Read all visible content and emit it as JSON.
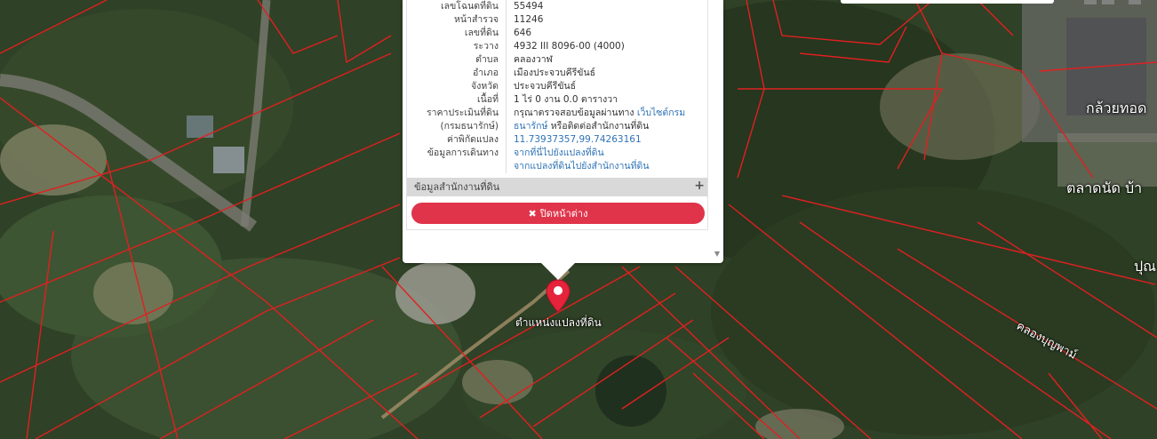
{
  "colors": {
    "parcel_line": "#e02020",
    "close_button": "#e0344a",
    "link": "#2f73b5",
    "marker": "#e5233a"
  },
  "parcel_info": [
    {
      "key": "เลขโฉนดที่ดิน",
      "value": "55494"
    },
    {
      "key": "หน้าสำรวจ",
      "value": "11246"
    },
    {
      "key": "เลขที่ดิน",
      "value": "646"
    },
    {
      "key": "ระวาง",
      "value": "4932 III 8096-00 (4000)"
    },
    {
      "key": "ตำบล",
      "value": "คลองวาฬ"
    },
    {
      "key": "อำเภอ",
      "value": "เมืองประจวบคีรีขันธ์"
    },
    {
      "key": "จังหวัด",
      "value": "ประจวบคีรีขันธ์"
    },
    {
      "key": "เนื้อที่",
      "value": "1 ไร่ 0 งาน 0.0 ตารางวา"
    }
  ],
  "price": {
    "key_line1": "ราคาประเมินที่ดิน",
    "key_line2": "(กรมธนารักษ์)",
    "text1": "กรุณาตรวจสอบข้อมูลผ่านทาง",
    "link1": "เว็บไซต์กรม",
    "link2": "ธนารักษ์",
    "text2": "หรือติดต่อสำนักงานที่ดิน"
  },
  "coords": {
    "key": "ค่าพิกัดแปลง",
    "value": "11.73937357,99.74263161"
  },
  "travel": {
    "key": "ข้อมูลการเดินทาง",
    "link1": "จากที่นี่ไปยังแปลงที่ดิน",
    "link2": "จากแปลงที่ดินไปยังสำนักงานที่ดิน"
  },
  "office_section": {
    "label": "ข้อมูลสำนักงานที่ดิน",
    "expand_symbol": "+"
  },
  "close_button": {
    "icon": "✖",
    "label": "ปิดหน้าต่าง"
  },
  "scroll_symbol": "▼",
  "marker_label": "ตำแหน่งแปลงที่ดิน",
  "map_labels": {
    "kluaithod": "กล้วยทอด",
    "talat": "ตลาดนัด บ้า",
    "pun": "ปุณ",
    "khlong": "คลองบุญพาม์"
  },
  "icons": {
    "marker": "map-pin-icon",
    "close": "close-icon",
    "expand": "plus-icon"
  }
}
